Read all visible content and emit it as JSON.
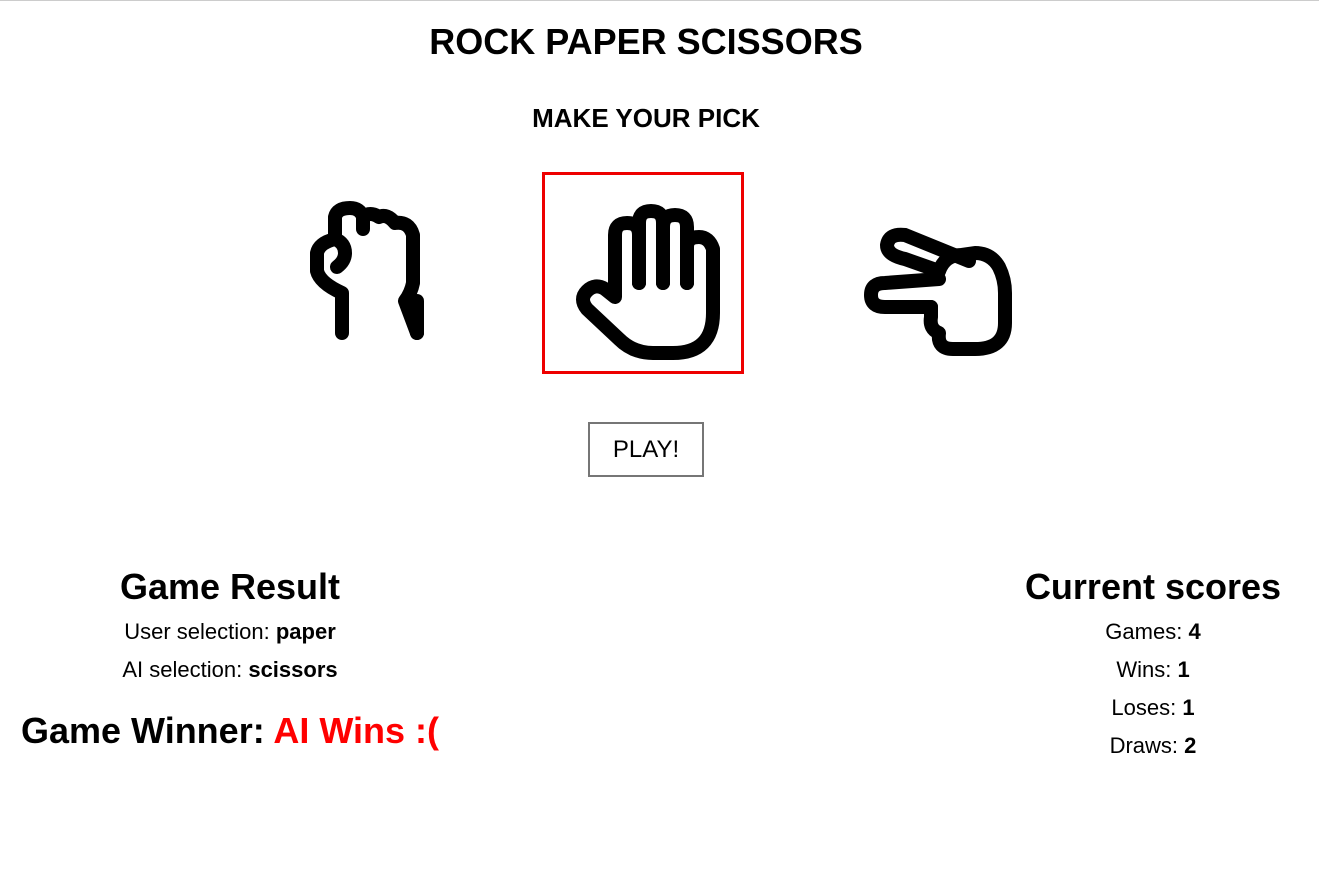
{
  "header": {
    "title": "ROCK PAPER SCISSORS",
    "subtitle": "MAKE YOUR PICK"
  },
  "choices": [
    {
      "name": "rock",
      "icon": "rock-fist-icon",
      "selected": false
    },
    {
      "name": "paper",
      "icon": "paper-hand-icon",
      "selected": true
    },
    {
      "name": "scissors",
      "icon": "scissors-hand-icon",
      "selected": false
    }
  ],
  "colors": {
    "selection_border": "#ee0000",
    "ai_wins": "#ff0000"
  },
  "play_button": {
    "label": "PLAY!"
  },
  "result": {
    "heading": "Game Result",
    "user_label": "User selection: ",
    "user_value": "paper",
    "ai_label": "AI selection: ",
    "ai_value": "scissors",
    "winner_label": "Game Winner: ",
    "winner_value": "AI Wins :("
  },
  "scores": {
    "heading": "Current scores",
    "games_label": "Games: ",
    "games_value": "4",
    "wins_label": "Wins: ",
    "wins_value": "1",
    "loses_label": "Loses: ",
    "loses_value": "1",
    "draws_label": "Draws: ",
    "draws_value": "2"
  }
}
